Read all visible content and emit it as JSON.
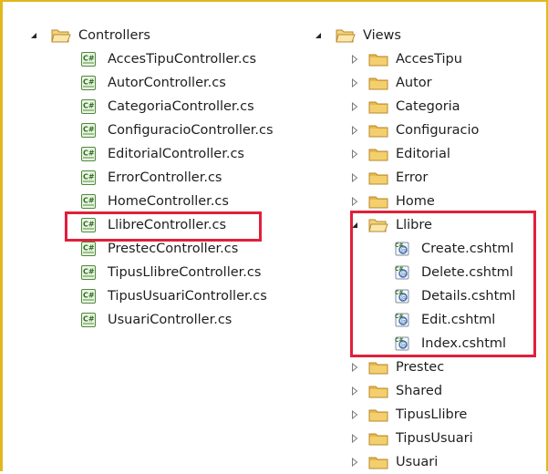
{
  "controllers": {
    "folder_label": "Controllers",
    "files": [
      "AccesTipuController.cs",
      "AutorController.cs",
      "CategoriaController.cs",
      "ConfiguracioController.cs",
      "EditorialController.cs",
      "ErrorController.cs",
      "HomeController.cs",
      "LlibreController.cs",
      "PrestecController.cs",
      "TipusLlibreController.cs",
      "TipusUsuariController.cs",
      "UsuariController.cs"
    ]
  },
  "views": {
    "folder_label": "Views",
    "folders_before": [
      "AccesTipu",
      "Autor",
      "Categoria",
      "Configuracio",
      "Editorial",
      "Error",
      "Home"
    ],
    "expanded_folder": {
      "label": "Llibre",
      "files": [
        "Create.cshtml",
        "Delete.cshtml",
        "Details.cshtml",
        "Edit.cshtml",
        "Index.cshtml"
      ]
    },
    "folders_after": [
      "Prestec",
      "Shared",
      "TipusLlibre",
      "TipusUsuari",
      "Usuari"
    ]
  },
  "colors": {
    "frame": "#e0b81c",
    "highlight": "#e0203a",
    "folder": "#e8b84a"
  }
}
